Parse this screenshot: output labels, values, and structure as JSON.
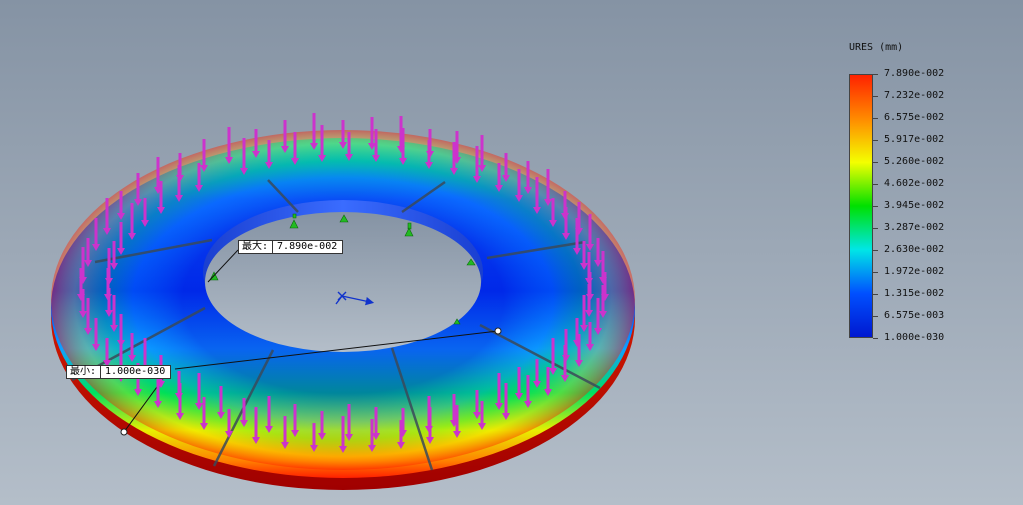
{
  "legend": {
    "title": "URES (mm)",
    "colorbar_colors": [
      "#ff2200",
      "#ff8a00",
      "#f4ff00",
      "#00e000",
      "#00e6e6",
      "#0050ff",
      "#0018d0"
    ],
    "ticks": [
      "7.890e-002",
      "7.232e-002",
      "6.575e-002",
      "5.917e-002",
      "5.260e-002",
      "4.602e-002",
      "3.945e-002",
      "3.287e-002",
      "2.630e-002",
      "1.972e-002",
      "1.315e-002",
      "6.575e-003",
      "1.000e-030"
    ]
  },
  "annotations": {
    "max": {
      "label": "最大:",
      "value": "7.890e-002"
    },
    "min": {
      "label": "最小:",
      "value": "1.000e-030"
    }
  },
  "model": {
    "shape": "annular-ring",
    "load_arrow_color": "#cc33cc",
    "fixture_color": "#22bb22",
    "triad_color": "#1133cc"
  }
}
